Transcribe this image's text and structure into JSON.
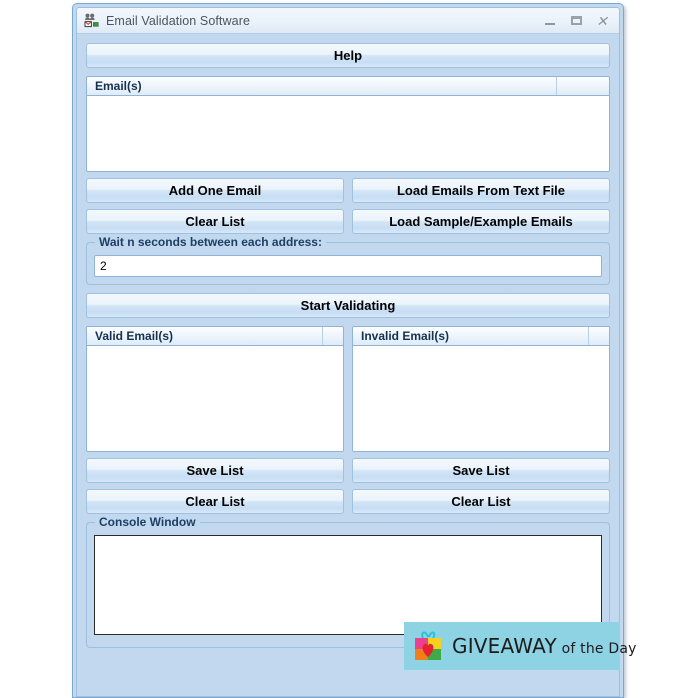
{
  "window": {
    "title": "Email Validation Software",
    "icon": "email-validation-app-icon",
    "controls": {
      "minimize": "minimize-button",
      "maximize": "maximize-button",
      "close": "close-button",
      "close_glyph": "✕"
    }
  },
  "help_button": {
    "label": "Help"
  },
  "email_list": {
    "header": "Email(s)",
    "rows": []
  },
  "actions": {
    "add_one_email": "Add One Email",
    "load_emails_from_text_file": "Load Emails From Text File",
    "clear_list": "Clear List",
    "load_sample_example_emails": "Load Sample/Example Emails"
  },
  "wait_group": {
    "legend": "Wait n seconds between each address:",
    "value": "2",
    "placeholder": ""
  },
  "start_button": {
    "label": "Start Validating"
  },
  "valid_list": {
    "header": "Valid Email(s)",
    "rows": [],
    "save_label": "Save List",
    "clear_label": "Clear List"
  },
  "invalid_list": {
    "header": "Invalid Email(s)",
    "rows": [],
    "save_label": "Save List",
    "clear_label": "Clear List"
  },
  "console_group": {
    "legend": "Console Window",
    "text": "",
    "placeholder": ""
  },
  "watermark": {
    "brand": "GIVEAWAY",
    "suffix": " of the Day",
    "background": "#8ed3e4"
  },
  "colors": {
    "window_background": "#c2d8ef",
    "titlebar": "#eef5fb",
    "button_border": "#9fc0de",
    "field_border": "#8fb4d8",
    "legend_text": "#1d3f63"
  }
}
